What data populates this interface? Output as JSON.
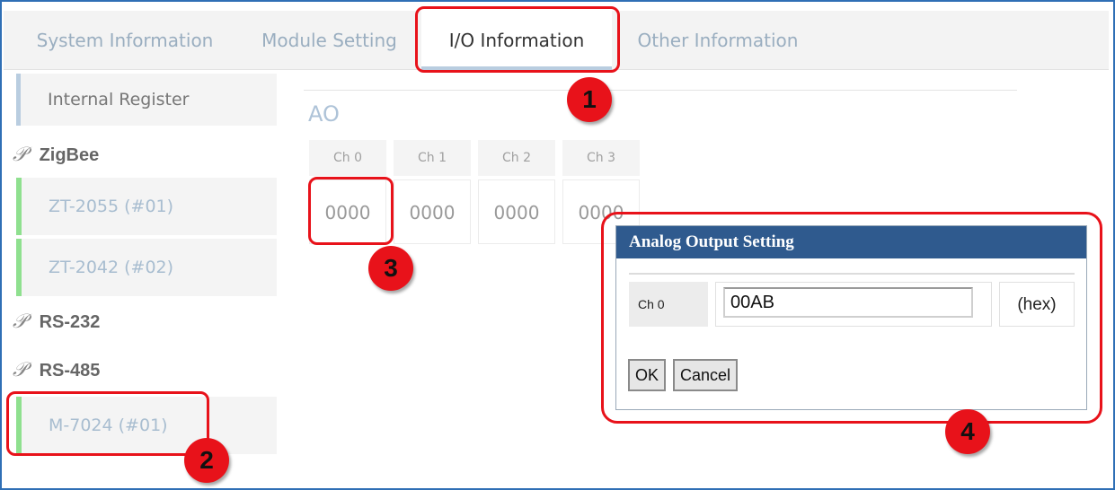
{
  "tabs": [
    {
      "label": "System Information"
    },
    {
      "label": "Module Setting"
    },
    {
      "label": "I/O Information"
    },
    {
      "label": "Other Information"
    }
  ],
  "sidebar": {
    "internal_register": "Internal Register",
    "groups": [
      {
        "label": "ZigBee",
        "devices": [
          "ZT-2055 (#01)",
          "ZT-2042 (#02)"
        ]
      },
      {
        "label": "RS-232",
        "devices": []
      },
      {
        "label": "RS-485",
        "devices": [
          "M-7024 (#01)"
        ]
      }
    ]
  },
  "main": {
    "section_title": "AO",
    "channels": [
      {
        "name": "Ch 0",
        "value": "0000"
      },
      {
        "name": "Ch 1",
        "value": "0000"
      },
      {
        "name": "Ch 2",
        "value": "0000"
      },
      {
        "name": "Ch 3",
        "value": "0000"
      }
    ]
  },
  "dialog": {
    "title": "Analog Output Setting",
    "channel_label": "Ch 0",
    "input_value": "00AB",
    "unit": "(hex)",
    "ok_label": "OK",
    "cancel_label": "Cancel"
  },
  "annotations": {
    "step1": "1",
    "step2": "2",
    "step3": "3",
    "step4": "4",
    "highlight_color": "#e8121a"
  },
  "colors": {
    "dialog_title_bg": "#2f5a8e",
    "device_accent": "#8fe08f",
    "frame_border": "#2f6fb5"
  }
}
